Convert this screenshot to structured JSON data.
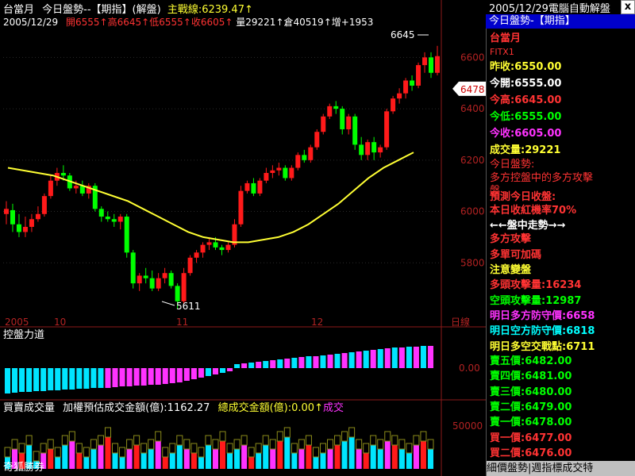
{
  "header": {
    "line1": {
      "name": "台當月",
      "title": "今日盤勢--【期指】(解盤)",
      "main_line_label": "主戰線:6239.47",
      "arrow": "↑"
    },
    "line2": {
      "date": "2005/12/29",
      "open": "開6555",
      "high": "高6645",
      "low": "低6555",
      "close": "收6605",
      "volume": "量29221",
      "oi": "倉40519",
      "change": "增+1953",
      "up_arrow": "↑"
    }
  },
  "main_chart": {
    "y_ticks": [
      "6600",
      "6400",
      "6200",
      "6000",
      "5800"
    ],
    "x_labels": [
      "2005",
      "10",
      "11",
      "12"
    ],
    "x_right_label": "日線",
    "current_price_tag": "6478",
    "high_annotation": "6645",
    "low_annotation": "5611"
  },
  "chart_data": {
    "type": "candlestick",
    "title": "今日盤勢--【期指】(解盤)",
    "ylim": [
      5600,
      6700
    ],
    "candles": [
      [
        5990,
        6040,
        5950,
        6010
      ],
      [
        6005,
        6030,
        5920,
        5950
      ],
      [
        5950,
        5990,
        5900,
        5920
      ],
      [
        5920,
        5980,
        5900,
        5940
      ],
      [
        5940,
        5990,
        5920,
        5970
      ],
      [
        5970,
        6020,
        5960,
        5990
      ],
      [
        5990,
        6070,
        5980,
        6060
      ],
      [
        6060,
        6140,
        6050,
        6120
      ],
      [
        6120,
        6170,
        6100,
        6150
      ],
      [
        6150,
        6180,
        6120,
        6140
      ],
      [
        6140,
        6150,
        6080,
        6090
      ],
      [
        6090,
        6120,
        6070,
        6100
      ],
      [
        6100,
        6120,
        6060,
        6070
      ],
      [
        6070,
        6110,
        6050,
        6100
      ],
      [
        6100,
        6110,
        6000,
        6010
      ],
      [
        6010,
        6020,
        5960,
        5980
      ],
      [
        5980,
        6000,
        5960,
        5970
      ],
      [
        5970,
        5990,
        5940,
        5960
      ],
      [
        5960,
        5990,
        5930,
        5980
      ],
      [
        5980,
        5990,
        5820,
        5840
      ],
      [
        5840,
        5850,
        5700,
        5720
      ],
      [
        5720,
        5760,
        5690,
        5750
      ],
      [
        5750,
        5780,
        5720,
        5740
      ],
      [
        5740,
        5770,
        5690,
        5700
      ],
      [
        5700,
        5760,
        5690,
        5740
      ],
      [
        5740,
        5780,
        5720,
        5760
      ],
      [
        5760,
        5770,
        5700,
        5710
      ],
      [
        5710,
        5720,
        5620,
        5650
      ],
      [
        5650,
        5780,
        5640,
        5760
      ],
      [
        5760,
        5830,
        5750,
        5820
      ],
      [
        5820,
        5850,
        5800,
        5840
      ],
      [
        5840,
        5880,
        5820,
        5870
      ],
      [
        5870,
        5900,
        5850,
        5880
      ],
      [
        5880,
        5900,
        5850,
        5860
      ],
      [
        5860,
        5870,
        5830,
        5850
      ],
      [
        5850,
        5880,
        5840,
        5870
      ],
      [
        5870,
        5970,
        5860,
        5950
      ],
      [
        5950,
        6100,
        5940,
        6080
      ],
      [
        6080,
        6120,
        6070,
        6110
      ],
      [
        6110,
        6130,
        6060,
        6070
      ],
      [
        6070,
        6130,
        6060,
        6120
      ],
      [
        6120,
        6170,
        6110,
        6150
      ],
      [
        6150,
        6180,
        6130,
        6160
      ],
      [
        6160,
        6190,
        6140,
        6170
      ],
      [
        6170,
        6180,
        6120,
        6130
      ],
      [
        6130,
        6180,
        6120,
        6170
      ],
      [
        6170,
        6230,
        6160,
        6220
      ],
      [
        6220,
        6240,
        6190,
        6200
      ],
      [
        6200,
        6260,
        6190,
        6250
      ],
      [
        6250,
        6320,
        6240,
        6310
      ],
      [
        6310,
        6380,
        6300,
        6370
      ],
      [
        6370,
        6420,
        6360,
        6410
      ],
      [
        6410,
        6430,
        6380,
        6400
      ],
      [
        6400,
        6410,
        6300,
        6320
      ],
      [
        6320,
        6380,
        6300,
        6370
      ],
      [
        6370,
        6380,
        6240,
        6260
      ],
      [
        6260,
        6290,
        6200,
        6220
      ],
      [
        6220,
        6280,
        6200,
        6270
      ],
      [
        6270,
        6290,
        6200,
        6230
      ],
      [
        6230,
        6260,
        6210,
        6250
      ],
      [
        6250,
        6400,
        6240,
        6390
      ],
      [
        6390,
        6450,
        6380,
        6440
      ],
      [
        6440,
        6480,
        6420,
        6460
      ],
      [
        6460,
        6520,
        6440,
        6510
      ],
      [
        6510,
        6530,
        6470,
        6490
      ],
      [
        6490,
        6580,
        6480,
        6570
      ],
      [
        6570,
        6620,
        6540,
        6600
      ],
      [
        6600,
        6620,
        6520,
        6540
      ],
      [
        6540,
        6645,
        6530,
        6605
      ]
    ],
    "ma_line": {
      "name": "主戰線",
      "values": [
        6170,
        6160,
        6150,
        6140,
        6120,
        6100,
        6080,
        6060,
        6040,
        6010,
        5980,
        5950,
        5920,
        5900,
        5890,
        5880,
        5880,
        5890,
        5900,
        5920,
        5950,
        5990,
        6030,
        6080,
        6130,
        6170,
        6200,
        6230
      ]
    }
  },
  "power_panel": {
    "title": "控盤力道",
    "zero_label": "0.00",
    "values": [
      -32,
      -31,
      -30,
      -30,
      -29,
      -29,
      -28,
      -28,
      -27,
      -27,
      -26,
      -26,
      -25,
      -25,
      -25,
      -24,
      -23,
      -23,
      -22,
      -22,
      -21,
      -21,
      -20,
      -19,
      -18,
      -16,
      -14,
      -12,
      -10,
      -8,
      -6,
      -4,
      5,
      6,
      7,
      8,
      9,
      10,
      11,
      12,
      13,
      14,
      15,
      15,
      16,
      17,
      18,
      19,
      20,
      21,
      22,
      23,
      24,
      25,
      26,
      26,
      27,
      27,
      28,
      28
    ],
    "pos_color": "#00e5ff",
    "neg_color": "#ff33ff"
  },
  "volume_panel": {
    "title": "買賣成交量",
    "metric1": "加權預估成交金額(億):1162.27",
    "metric2": "總成交金額(億):0.00",
    "arrow": "↑",
    "trailing": "成交",
    "y_label": "50000",
    "bottom_label": "奇狐勝券",
    "bars": [
      3,
      5,
      4,
      6,
      2,
      4,
      5,
      3,
      6,
      7,
      4,
      3,
      5,
      6,
      8,
      4,
      3,
      5,
      6,
      4,
      5,
      7,
      3,
      4,
      6,
      5,
      4,
      3,
      6,
      5,
      7,
      4,
      5,
      6,
      3,
      4,
      6,
      5,
      7,
      8,
      4,
      5,
      6,
      3,
      4,
      5,
      6,
      7,
      8,
      5,
      4,
      6,
      5,
      7,
      6,
      5,
      4,
      6,
      7,
      5
    ]
  },
  "side_panel": {
    "title": "2005/12/29電腦自動解盤",
    "subtitle": "今日盤勢-【期指】",
    "name": "台當月",
    "code": "FITX1",
    "prev_close": "昨收:6550.00",
    "open": "今開:6555.00",
    "high": "今高:6645.00",
    "low": "今低:6555.00",
    "close": "今收:6605.00",
    "volume": "成交量:29221",
    "trend_title": "今日盤勢:",
    "trend_text1": "多方控盤中的多方攻擊",
    "trend_text2": "盤",
    "forecast_title": "預測今日收盤:",
    "forecast_text": "本日收紅機率70%",
    "intraday_title": "←←盤中走勢→→",
    "intraday1": "多方攻擊",
    "intraday2": "多單可加碼",
    "watch": "注意變盤",
    "bull_attack": "多頭攻擊量:16234",
    "bear_attack": "空頭攻擊量:12987",
    "bull_defense": "明日多方防守價:6658",
    "bear_defense": "明日空方防守價:6818",
    "pivot": "明日多空交戰點:6711",
    "ask5": "賣五價:6482.00",
    "ask4": "賣四價:6481.00",
    "ask3": "賣三價:6480.00",
    "ask2": "賣二價:6479.00",
    "ask1": "賣一價:6478.00",
    "bid1": "買一價:6477.00",
    "bid2": "買二價:6476.00",
    "footer": "細價盤勢|週指標成交特"
  },
  "window": {
    "close_glyph": "x"
  },
  "colors": {
    "up": "#ff1a1a",
    "down": "#00ff00",
    "ma": "#ffff33",
    "axis": "#8b1a1a",
    "grid": "#2a2a2a"
  }
}
